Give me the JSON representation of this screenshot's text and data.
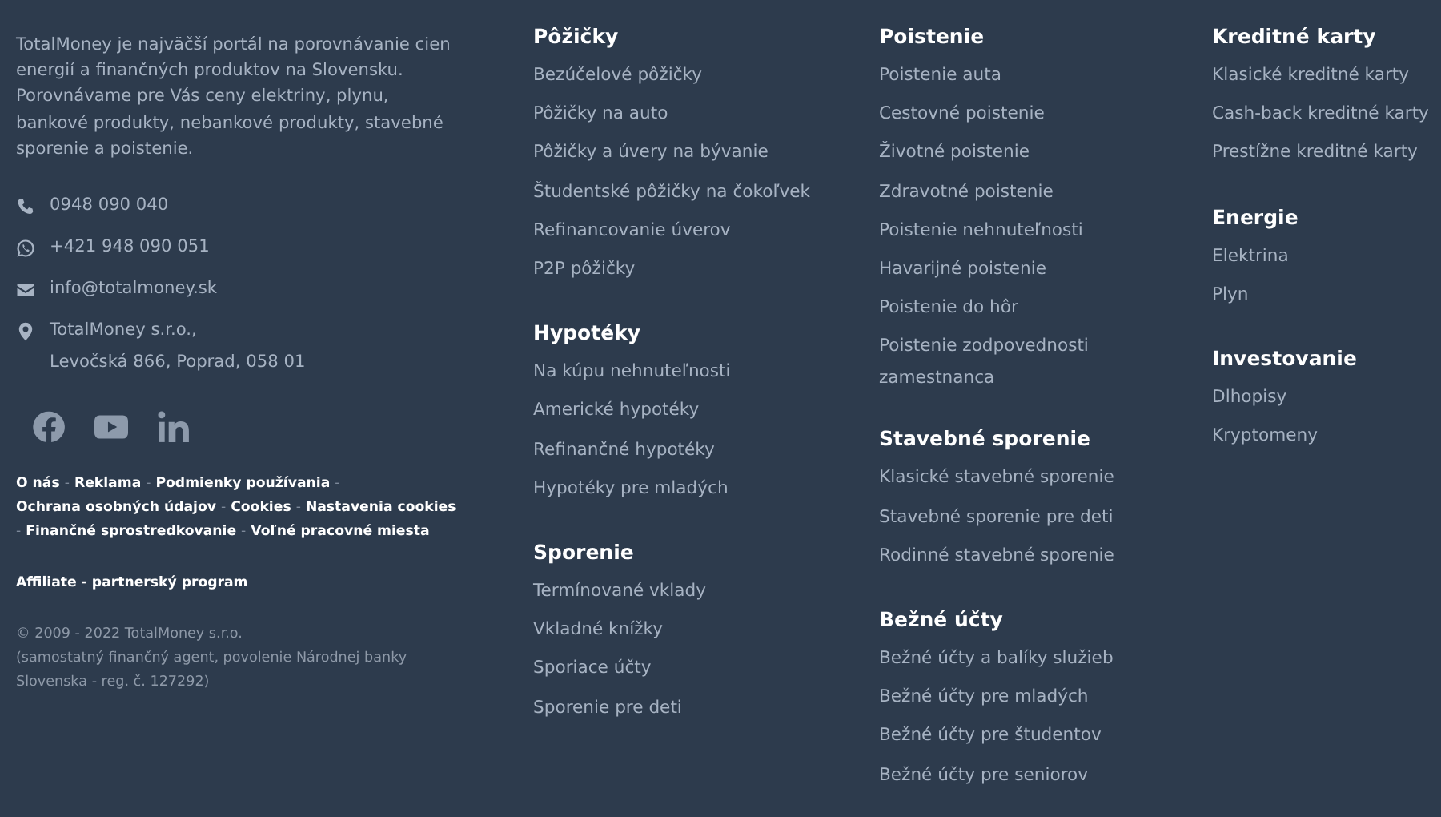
{
  "about": {
    "text": "TotalMoney je najväčší portál na porovnávanie cien energií a finančných produktov na Slovensku. Porovnávame pre Vás ceny elektriny, plynu, bankové produkty, nebankové produkty, stavebné sporenie a poistenie.",
    "contacts": [
      {
        "kind": "phone",
        "lines": [
          "0948 090 040"
        ]
      },
      {
        "kind": "whatsapp",
        "lines": [
          "+421 948 090 051"
        ]
      },
      {
        "kind": "email",
        "lines": [
          "info@totalmoney.sk"
        ]
      },
      {
        "kind": "address",
        "lines": [
          "TotalMoney s.r.o.,",
          "Levočská 866, Poprad, 058 01"
        ]
      }
    ],
    "social": [
      {
        "kind": "facebook"
      },
      {
        "kind": "youtube"
      },
      {
        "kind": "linkedin"
      }
    ],
    "legal_links": [
      {
        "kind": "link",
        "text": "O nás"
      },
      {
        "kind": "separator",
        "text": "-"
      },
      {
        "kind": "link",
        "text": "Reklama"
      },
      {
        "kind": "separator",
        "text": "-"
      },
      {
        "kind": "link",
        "text": "Podmienky používania"
      },
      {
        "kind": "separator",
        "text": "-"
      },
      {
        "kind": "link",
        "text": "Ochrana osobných údajov"
      },
      {
        "kind": "separator",
        "text": "-"
      },
      {
        "kind": "link",
        "text": "Cookies"
      },
      {
        "kind": "separator",
        "text": "-"
      },
      {
        "kind": "link",
        "text": "Nastavenia cookies"
      },
      {
        "kind": "separator",
        "text": "-"
      },
      {
        "kind": "link",
        "text": "Finančné sprostredkovanie"
      },
      {
        "kind": "separator",
        "text": "-"
      },
      {
        "kind": "link",
        "text": "Voľné pracovné miesta"
      }
    ],
    "affiliate": "Affiliate - partnerský program",
    "copyright": [
      "© 2009 - 2022 TotalMoney s.r.o.",
      "(samostatný finančný agent, povolenie Národnej banky Slovenska - reg. č. 127292)"
    ]
  },
  "columns": [
    [
      {
        "title": "Pôžičky",
        "links": [
          "Bezúčelové pôžičky",
          "Pôžičky na auto",
          "Pôžičky a úvery na bývanie",
          "Študentské pôžičky na čokoľvek",
          "Refinancovanie úverov",
          "P2P pôžičky"
        ]
      },
      {
        "title": "Hypotéky",
        "links": [
          "Na kúpu nehnuteľnosti",
          "Americké hypotéky",
          "Refinančné hypotéky",
          "Hypotéky pre mladých"
        ]
      },
      {
        "title": "Sporenie",
        "links": [
          "Termínované vklady",
          "Vkladné knížky",
          "Sporiace účty",
          "Sporenie pre deti"
        ]
      }
    ],
    [
      {
        "title": "Poistenie",
        "links": [
          "Poistenie auta",
          "Cestovné poistenie",
          "Životné poistenie",
          "Zdravotné poistenie",
          "Poistenie nehnuteľnosti",
          "Havarijné poistenie",
          "Poistenie do hôr",
          "Poistenie zodpovednosti zamestnanca"
        ]
      },
      {
        "title": "Stavebné sporenie",
        "links": [
          "Klasické stavebné sporenie",
          "Stavebné sporenie pre deti",
          "Rodinné stavebné sporenie"
        ]
      },
      {
        "title": "Bežné účty",
        "links": [
          "Bežné účty a balíky služieb",
          "Bežné účty pre mladých",
          "Bežné účty pre študentov",
          "Bežné účty pre seniorov"
        ]
      }
    ],
    [
      {
        "title": "Kreditné karty",
        "links": [
          "Klasické kreditné karty",
          "Cash-back kreditné karty",
          "Prestížne kreditné karty"
        ]
      },
      {
        "title": "Energie",
        "links": [
          "Elektrina",
          "Plyn"
        ]
      },
      {
        "title": "Investovanie",
        "links": [
          "Dlhopisy",
          "Kryptomeny"
        ]
      }
    ]
  ]
}
